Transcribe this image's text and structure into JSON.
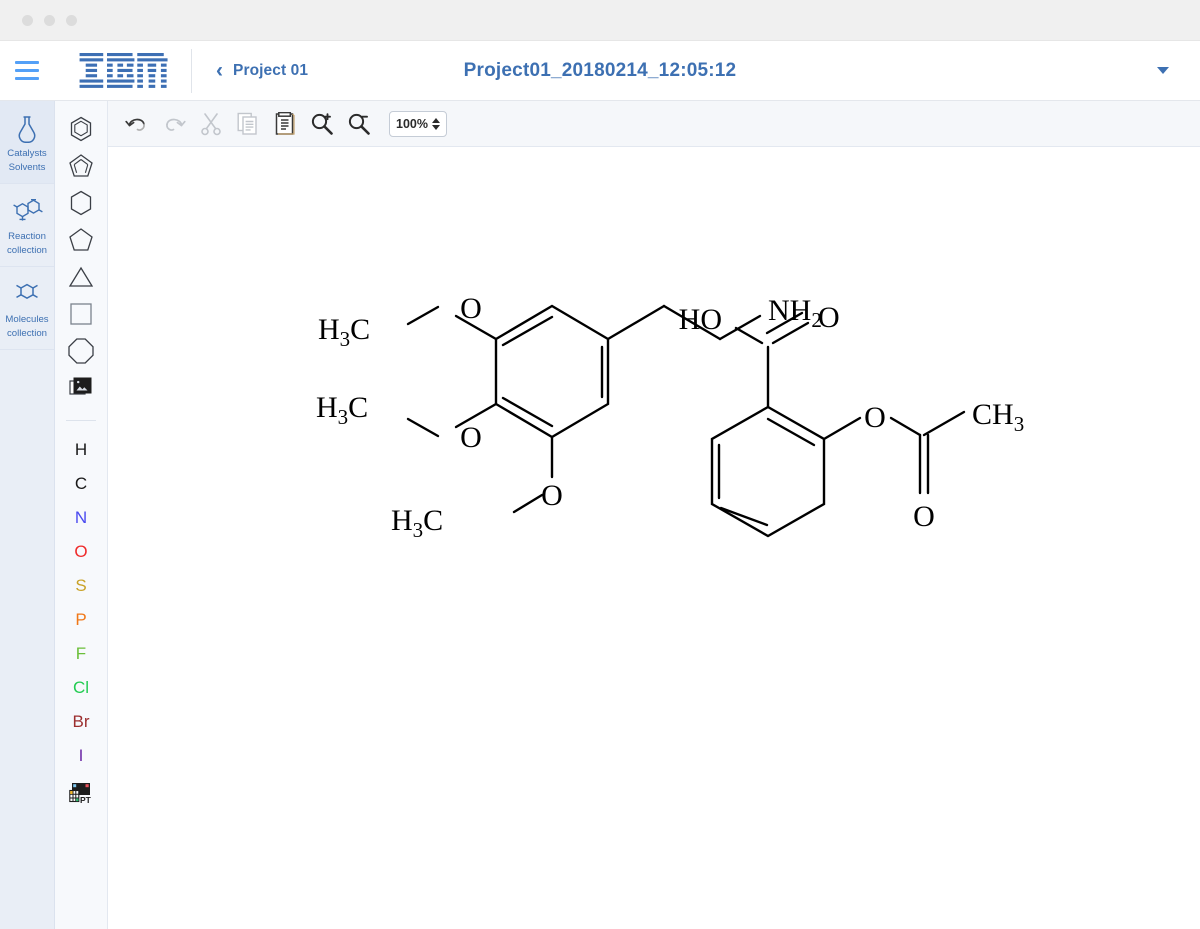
{
  "window": {
    "traffic_dots": [
      "close",
      "minimize",
      "maximize"
    ]
  },
  "header": {
    "menu_icon": "hamburger-icon",
    "brand": "IBM",
    "back_chevron": "chevron-left-icon",
    "back_label": "Project 01",
    "project_title": "Project01_20180214_12:05:12",
    "dropdown_icon": "caret-down-icon",
    "accent_color": "#3d70b2",
    "menu_color": "#54a0f7"
  },
  "left_rail": {
    "items": [
      {
        "icon": "flask-icon",
        "line1": "Catalysts",
        "line2": "Solvents",
        "selected": true
      },
      {
        "icon": "reaction-molecules-icon",
        "line1": "Reaction",
        "line2": "collection",
        "selected": false
      },
      {
        "icon": "benzene-ring-icon",
        "line1": "Molecules",
        "line2": "collection",
        "selected": false
      }
    ]
  },
  "toolbar": {
    "buttons": [
      {
        "name": "undo-button",
        "icon": "undo-arrow-icon",
        "enabled": true
      },
      {
        "name": "redo-button",
        "icon": "redo-arrow-icon",
        "enabled": false
      },
      {
        "name": "cut-button",
        "icon": "scissors-icon",
        "enabled": false
      },
      {
        "name": "copy-button",
        "icon": "copy-pages-icon",
        "enabled": false
      },
      {
        "name": "paste-button",
        "icon": "clipboard-icon",
        "enabled": true
      },
      {
        "name": "zoom-in-button",
        "icon": "magnifier-plus-icon",
        "enabled": true
      },
      {
        "name": "zoom-out-button",
        "icon": "magnifier-minus-icon",
        "enabled": true
      }
    ],
    "zoom_value": "100%",
    "zoom_stepper_icon": "up-down-arrows-icon"
  },
  "tool_palette": {
    "shapes": [
      {
        "name": "benzene-tool",
        "icon": "benzene-hexagon-icon"
      },
      {
        "name": "cyclopentadiene-tool",
        "icon": "cyclopentadiene-pentagon-icon"
      },
      {
        "name": "cyclohexane-tool",
        "icon": "hexagon-icon"
      },
      {
        "name": "cyclopentane-tool",
        "icon": "pentagon-icon"
      },
      {
        "name": "cyclopropane-tool",
        "icon": "triangle-icon"
      },
      {
        "name": "cyclobutane-tool",
        "icon": "square-icon"
      },
      {
        "name": "cyclooctane-tool",
        "icon": "octagon-icon"
      },
      {
        "name": "template-image-tool",
        "icon": "images-stack-icon"
      }
    ],
    "elements": [
      {
        "symbol": "H",
        "color": "#1a1a1a"
      },
      {
        "symbol": "C",
        "color": "#1a1a1a"
      },
      {
        "symbol": "N",
        "color": "#4a4af0"
      },
      {
        "symbol": "O",
        "color": "#ef2b2b"
      },
      {
        "symbol": "S",
        "color": "#c9a227"
      },
      {
        "symbol": "P",
        "color": "#f07818"
      },
      {
        "symbol": "F",
        "color": "#6bbf3a"
      },
      {
        "symbol": "Cl",
        "color": "#23cc52"
      },
      {
        "symbol": "Br",
        "color": "#9c2f2f"
      },
      {
        "symbol": "I",
        "color": "#6f2da8"
      }
    ],
    "periodic_table": {
      "name": "periodic-table-tool",
      "label": "PT",
      "icon": "periodic-table-icon"
    }
  },
  "canvas": {
    "molecules": [
      {
        "name": "mescaline",
        "labels": [
          "H",
          "3",
          "C",
          "O",
          "H",
          "3",
          "C",
          "O",
          "H",
          "3",
          "C",
          "O",
          "N",
          "H",
          "2"
        ],
        "formula_labels": [
          "H3C",
          "O",
          "H3C",
          "O",
          "H3C",
          "O",
          "NH2"
        ]
      },
      {
        "name": "acetylsalicylic-acid",
        "formula_labels": [
          "HO",
          "O",
          "O",
          "CH3",
          "O"
        ]
      }
    ]
  }
}
